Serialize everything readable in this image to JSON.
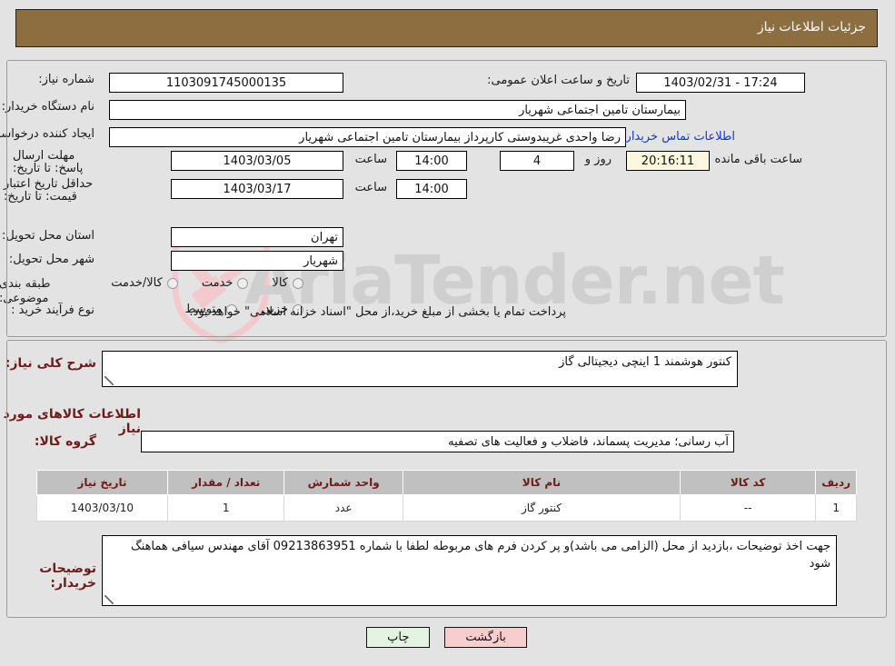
{
  "header": {
    "title": "جزئیات اطلاعات نیاز"
  },
  "watermark": {
    "text": "AriaTender.net",
    "logo": "shield-gavel-icon"
  },
  "form": {
    "need_number": {
      "label": "شماره نیاز:",
      "value": "1103091745000135"
    },
    "public_announce": {
      "label": "تاریخ و ساعت اعلان عمومی:",
      "value": "17:24 - 1403/02/31"
    },
    "buyer_org": {
      "label": "نام دستگاه خریدار:",
      "value": "بیمارستان تامین اجتماعی شهریار"
    },
    "requester": {
      "label": "ایجاد کننده درخواست:",
      "value": "رضا واحدی غریبدوستی کارپرداز بیمارستان تامین اجتماعی شهریار"
    },
    "contact_link": {
      "label": "اطلاعات تماس خریدار"
    },
    "response_deadline": {
      "label": "مهلت ارسال پاسخ: تا تاریخ:",
      "date": "1403/03/05",
      "time_label": "ساعت",
      "time": "14:00"
    },
    "countdown": {
      "days": "4",
      "days_label": "روز و",
      "clock": "20:16:11",
      "suffix": "ساعت باقی مانده"
    },
    "price_validity": {
      "label": "حداقل تاریخ اعتبار قیمت: تا تاریخ:",
      "date": "1403/03/17",
      "time_label": "ساعت",
      "time": "14:00"
    },
    "province": {
      "label": "استان محل تحویل:",
      "value": "تهران"
    },
    "city": {
      "label": "شهر محل تحویل:",
      "value": "شهریار"
    },
    "category": {
      "label": "طبقه بندی موضوعی:",
      "options": [
        "کالا",
        "خدمت",
        "کالا/خدمت"
      ]
    },
    "purchase_type": {
      "label": "نوع فرآیند خرید :",
      "options": [
        "جزیی",
        "متوسط"
      ],
      "note": "پرداخت تمام یا بخشی از مبلغ خرید،از محل \"اسناد خزانه اسلامی\" خواهد بود."
    }
  },
  "details": {
    "general_desc": {
      "label": "شرح کلی نیاز:",
      "value": "کنتور هوشمند 1 اینچی دیجیتالی گاز"
    },
    "goods_section_title": "اطلاعات کالاهای مورد نیاز",
    "goods_group": {
      "label": "گروه کالا:",
      "value": "آب رسانی؛ مدیریت پسماند، فاضلاب و فعالیت های تصفیه"
    },
    "table": {
      "columns": [
        "ردیف",
        "کد کالا",
        "نام کالا",
        "واحد شمارش",
        "تعداد / مقدار",
        "تاریخ نیاز"
      ],
      "rows": [
        [
          "1",
          "--",
          "کنتور گاز",
          "عدد",
          "1",
          "1403/03/10"
        ]
      ]
    },
    "buyer_notes": {
      "label": "توضیحات خریدار:",
      "value": "جهت اخذ توضیحات ،بازدید از محل (الزامی می باشد)و پر کردن فرم های مربوطه لطفا با شماره 09213863951 آقای مهندس سیافی هماهنگ شود"
    }
  },
  "buttons": {
    "print": "چاپ",
    "back": "بازگشت"
  }
}
